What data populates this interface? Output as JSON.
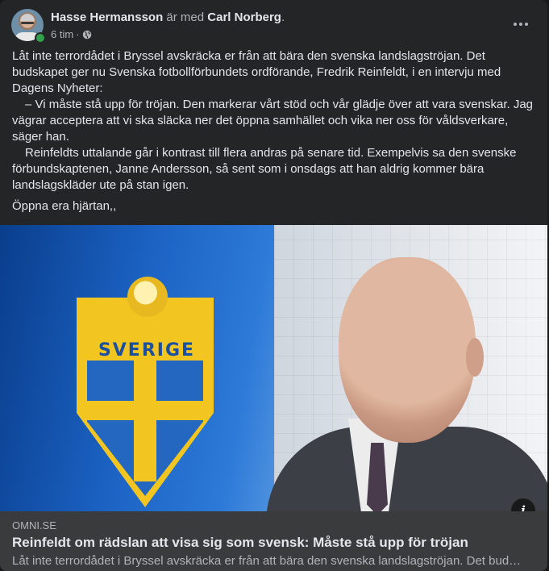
{
  "post": {
    "author": "Hasse Hermansson",
    "with_text": "är med",
    "tagged": "Carl Norberg",
    "tagged_suffix": ".",
    "time": "6 tim",
    "separator": "·",
    "privacy_icon": "globe-icon",
    "more_icon": "more-horizontal-icon",
    "paragraphs": [
      "Låt inte terrordådet i Bryssel avskräcka er från att bära den svenska landslagströjan. Det budskapet ger nu Svenska fotbollförbundets ordförande, Fredrik Reinfeldt, i en intervju med Dagens Nyheter:",
      "– Vi måste stå upp för tröjan. Den markerar vårt stöd och vår glädje över att vara svenskar. Jag vägrar acceptera att vi ska släcka ner det öppna samhället och vika ner oss för våldsverkare, säger han.",
      "Reinfeldts uttalande går i kontrast till flera andras på senare tid. Exempelvis sa den svenske förbundskaptenen, Janne Andersson, så sent som i onsdags att han aldrig kommer bära landslagskläder ute på stan igen.",
      "Öppna era hjärtan,,"
    ]
  },
  "link": {
    "image_label": "SVERIGE",
    "domain": "OMNI.SE",
    "title": "Reinfeldt om rädslan att visa sig som svensk: Måste stå upp för tröjan",
    "description": "Låt inte terrordådet i Bryssel avskräcka er från att bära den svenska landslagströjan. Det bud…",
    "info_icon": "info-icon",
    "info_glyph": "i"
  },
  "colors": {
    "card_bg": "#242526",
    "online": "#31a24c",
    "link_meta_bg": "#3a3b3c"
  }
}
